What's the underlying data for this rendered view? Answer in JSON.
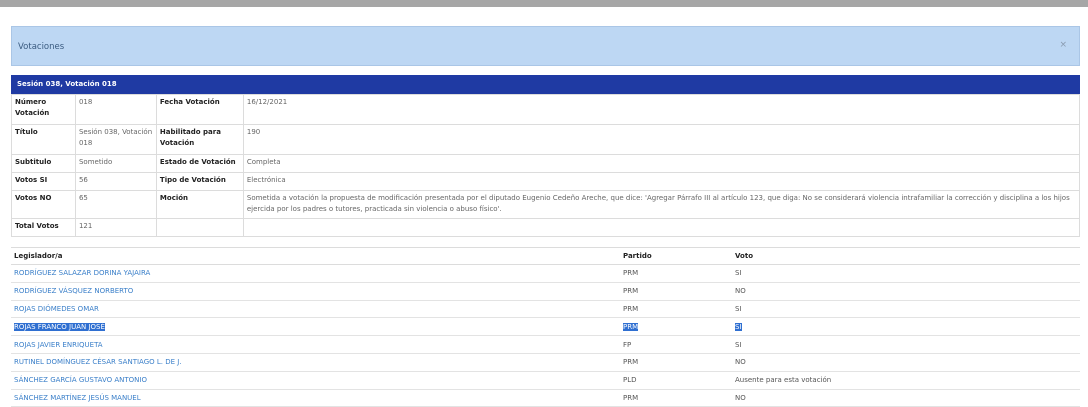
{
  "modal": {
    "title": "Votaciones",
    "close_label": "×"
  },
  "session_title": "Sesión 038, Votación 018",
  "info": {
    "numero_label": "Número Votación",
    "numero": "018",
    "fecha_label": "Fecha Votación",
    "fecha": "16/12/2021",
    "titulo_label": "Título",
    "titulo": "Sesión 038, Votación 018",
    "habilitado_label": "Habilitado para Votación",
    "habilitado": "190",
    "subtitulo_label": "Subtitulo",
    "subtitulo": "Sometido",
    "estado_label": "Estado de Votación",
    "estado": "Completa",
    "si_label": "Votos SI",
    "si": "56",
    "tipo_label": "Tipo de Votación",
    "tipo": "Electrónica",
    "no_label": "Votos NO",
    "no": "65",
    "mocion_label": "Moción",
    "mocion": "Sometida a votación la propuesta de modificación presentada por el diputado Eugenio Cedeño Areche, que dice: 'Agregar Párrafo III al artículo 123, que diga: No se considerará violencia intrafamiliar la corrección y disciplina a los hijos ejercida por los padres o tutores, practicada sin violencia o abuso físico'.",
    "total_label": "Total Votos",
    "total": "121"
  },
  "votes": {
    "headers": {
      "legislador": "Legislador/a",
      "partido": "Partido",
      "voto": "Voto"
    },
    "rows": [
      {
        "name": "RODRÍGUEZ SALAZAR DORINA YAJAIRA",
        "partido": "PRM",
        "voto": "SI"
      },
      {
        "name": "RODRÍGUEZ VÁSQUEZ NORBERTO",
        "partido": "PRM",
        "voto": "NO"
      },
      {
        "name": "ROJAS DIÓMEDES OMAR",
        "partido": "PRM",
        "voto": "SI"
      },
      {
        "name": "ROJAS FRANCO JUAN JOSÉ",
        "partido": "PRM",
        "voto": "SI"
      },
      {
        "name": "ROJAS JAVIER ENRIQUETA",
        "partido": "FP",
        "voto": "SI"
      },
      {
        "name": "RUTINEL DOMÍNGUEZ CÉSAR SANTIAGO L. DE J.",
        "partido": "PRM",
        "voto": "NO"
      },
      {
        "name": "SÁNCHEZ GARCÍA GUSTAVO ANTONIO",
        "partido": "PLD",
        "voto": "Ausente para esta votación"
      },
      {
        "name": "SÁNCHEZ MARTÍNEZ JESÚS MANUEL",
        "partido": "PRM",
        "voto": "NO"
      }
    ]
  }
}
